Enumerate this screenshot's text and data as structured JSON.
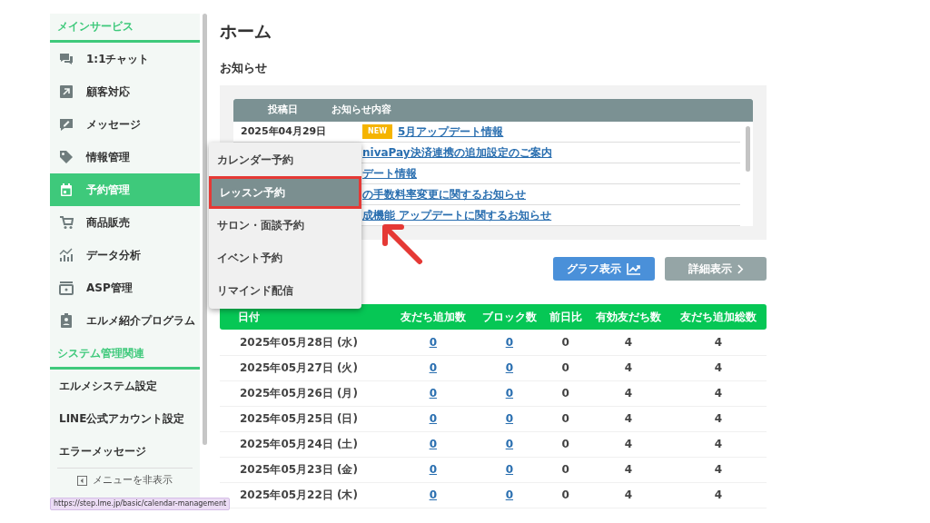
{
  "sidebar": {
    "sections": [
      {
        "title": "メインサービス",
        "items": [
          {
            "label": "1:1チャット",
            "selected": false
          },
          {
            "label": "顧客対応",
            "selected": false
          },
          {
            "label": "メッセージ",
            "selected": false
          },
          {
            "label": "情報管理",
            "selected": false
          },
          {
            "label": "予約管理",
            "selected": true
          },
          {
            "label": "商品販売",
            "selected": false
          },
          {
            "label": "データ分析",
            "selected": false
          },
          {
            "label": "ASP管理",
            "selected": false
          },
          {
            "label": "エルメ紹介プログラム",
            "selected": false
          }
        ]
      },
      {
        "title": "システム管理関連",
        "items": [
          {
            "label": "エルメシステム設定",
            "selected": false
          },
          {
            "label": "LINE公式アカウント設定",
            "selected": false
          },
          {
            "label": "エラーメッセージ",
            "selected": false
          }
        ]
      }
    ],
    "hide_menu": "メニューを非表示"
  },
  "page_title": "ホーム",
  "notices": {
    "title": "お知らせ",
    "columns": [
      "投稿日",
      "お知らせ内容"
    ],
    "rows": [
      {
        "date": "2025年04月29日",
        "badge": "NEW",
        "title": "5月アップデート情報"
      },
      {
        "title": "nivaPay決済連携の追加設定のご案内"
      },
      {
        "title": "デート情報"
      },
      {
        "title": "の手数料率変更に関するお知らせ"
      },
      {
        "title": "成機能 アップデートに関するお知らせ"
      }
    ]
  },
  "buttons": [
    {
      "label": "グラフ表示",
      "kind": "graph"
    },
    {
      "label": "詳細表示",
      "kind": "detail"
    }
  ],
  "stats_table": {
    "columns": [
      "日付",
      "友だち追加数",
      "ブロック数",
      "前日比",
      "有効友だち数",
      "友だち追加総数"
    ],
    "rows": [
      [
        "2025年05月28日 (水)",
        "0",
        "0",
        "0",
        "4",
        "4"
      ],
      [
        "2025年05月27日 (火)",
        "0",
        "0",
        "0",
        "4",
        "4"
      ],
      [
        "2025年05月26日 (月)",
        "0",
        "0",
        "0",
        "4",
        "4"
      ],
      [
        "2025年05月25日 (日)",
        "0",
        "0",
        "0",
        "4",
        "4"
      ],
      [
        "2025年05月24日 (土)",
        "0",
        "0",
        "0",
        "4",
        "4"
      ],
      [
        "2025年05月23日 (金)",
        "0",
        "0",
        "0",
        "4",
        "4"
      ],
      [
        "2025年05月22日 (木)",
        "0",
        "0",
        "0",
        "4",
        "4"
      ]
    ]
  },
  "dropdown": {
    "items": [
      {
        "label": "カレンダー予約",
        "selected": false
      },
      {
        "label": "レッスン予約",
        "selected": true
      },
      {
        "label": "サロン・面談予約",
        "selected": false
      },
      {
        "label": "イベント予約",
        "selected": false
      },
      {
        "label": "リマインド配信",
        "selected": false
      }
    ]
  },
  "status_url": "https://step.lme.jp/basic/calendar-management"
}
